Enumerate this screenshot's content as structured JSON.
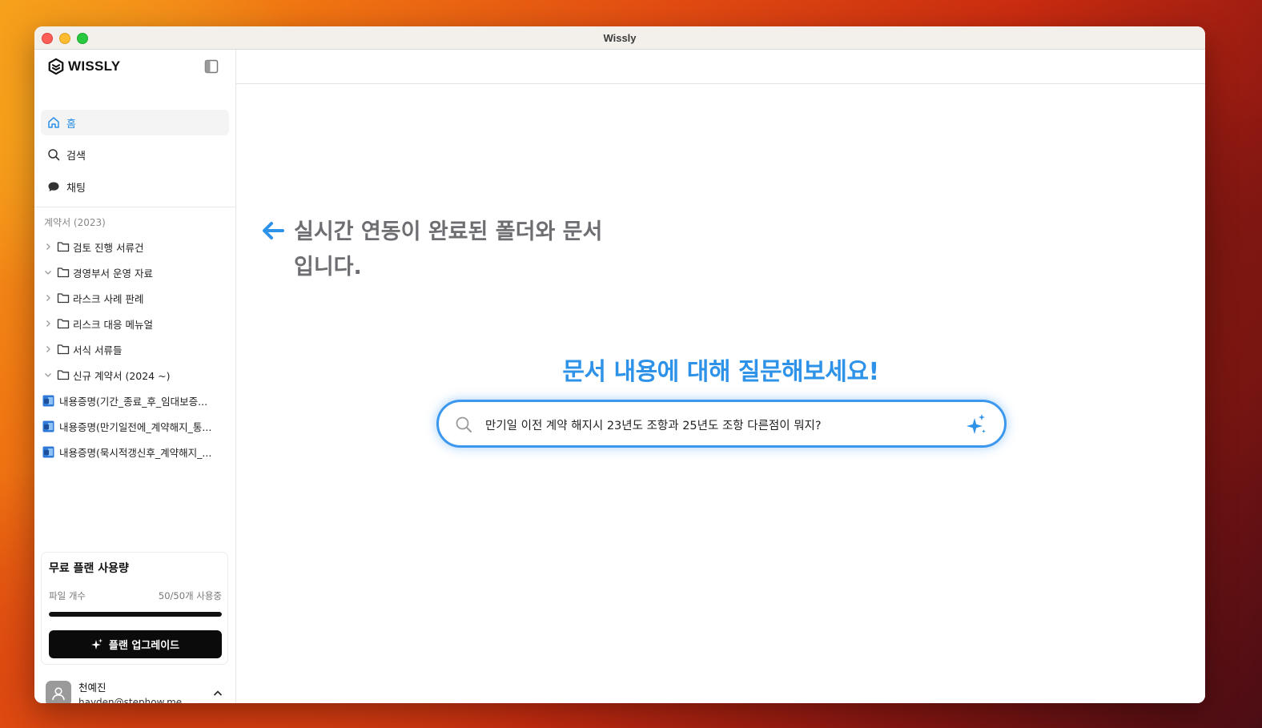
{
  "window": {
    "title": "Wissly"
  },
  "sidebar": {
    "brand": "WISSLY",
    "nav": [
      {
        "label": "홈",
        "icon": "home-icon",
        "active": true
      },
      {
        "label": "검색",
        "icon": "search-icon",
        "active": false
      },
      {
        "label": "채팅",
        "icon": "chat-bubble-icon",
        "active": false
      }
    ],
    "section_label": "계약서 (2023)",
    "folders": [
      {
        "label": "검토 진행 서류건",
        "expanded": false
      },
      {
        "label": "경영부서 운영 자료",
        "expanded": true
      },
      {
        "label": "라스크 사례 판례",
        "expanded": false
      },
      {
        "label": "리스크 대응 메뉴얼",
        "expanded": false
      },
      {
        "label": "서식 서류들",
        "expanded": false
      },
      {
        "label": "신규 계약서 (2024 ~)",
        "expanded": true
      }
    ],
    "files": [
      {
        "label": "내용증명(기간_종료_후_임대보증..."
      },
      {
        "label": "내용증명(만기일전에_계약해지_통..."
      },
      {
        "label": "내용증명(묵시적갱신후_계약해지_..."
      }
    ],
    "plan": {
      "title": "무료 플랜 사용량",
      "metric_label": "파일 개수",
      "metric_value": "50/50개 사용중",
      "usage_fraction": 1.0,
      "upgrade_label": "플랜 업그레이드"
    },
    "user": {
      "name": "천예진",
      "email": "hayden@stephow.me"
    }
  },
  "main": {
    "hint": "실시간 연동이 완료된 폴더와 문서입니다.",
    "headline": "문서 내용에 대해 질문해보세요!",
    "search": {
      "value": "만기일 이전 계약 해지시 23년도 조항과 25년도 조항 다른점이 뭐지?"
    }
  },
  "colors": {
    "accent": "#2e93e8",
    "hint_text": "#6d6d72",
    "upgrade_bg": "#0b0b0b"
  }
}
